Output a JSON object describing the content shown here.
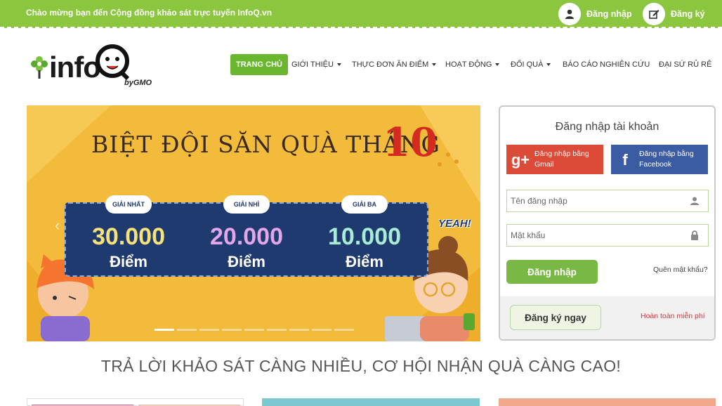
{
  "topbar": {
    "welcome": "Chào mừng bạn đến Cộng đồng khảo sát trực tuyến InfoQ.vn",
    "login_label": "Đăng nhập",
    "register_label": "Đăng ký",
    "bg_color": "#8cc63f"
  },
  "logo": {
    "text": "info",
    "by": "byGMO"
  },
  "nav": {
    "items": [
      {
        "label": "TRANG CHỦ",
        "active": true
      },
      {
        "label": "GIỚI THIỆU",
        "dropdown": true
      },
      {
        "label": "THỰC ĐƠN ĂN ĐIỂM",
        "dropdown": true
      },
      {
        "label": "HOẠT ĐỘNG",
        "dropdown": true
      },
      {
        "label": "ĐỔI QUÀ",
        "dropdown": true
      },
      {
        "label": "BÁO CÁO NGHIÊN CỨU"
      },
      {
        "label": "ĐẠI SỨ RỦ RÊ"
      }
    ],
    "accent": "#6ab72f"
  },
  "banner": {
    "title": "BIỆT ĐỘI SĂN QUÀ THÁNG",
    "month": "10",
    "prizes": [
      {
        "tab": "GIẢI NHẤT",
        "amount": "30.000",
        "unit": "Điểm",
        "color": "#f7e27a"
      },
      {
        "tab": "GIẢI NHÌ",
        "amount": "20.000",
        "unit": "Điểm",
        "color": "#e3a6e8"
      },
      {
        "tab": "GIẢI BA",
        "amount": "10.000",
        "unit": "Điểm",
        "color": "#a9ecd6"
      }
    ],
    "yeah": "YEAH!",
    "slide_count": 9,
    "active_slide": 1
  },
  "login": {
    "title": "Đăng nhập tài khoản",
    "gmail_line1": "Đăng nhập bằng",
    "gmail_line2": "Gmail",
    "facebook_line1": "Đăng nhập bằng",
    "facebook_line2": "Facebook",
    "username_placeholder": "Tên đăng nhập",
    "password_placeholder": "Mật khẩu",
    "login_button": "Đăng nhập",
    "forgot": "Quên mật khẩu?",
    "register_button": "Đăng ký ngay",
    "free_text": "Hoàn toàn miễn phí"
  },
  "tagline": "TRẢ LỜI KHẢO SÁT CÀNG NHIỀU, CƠ HỘI NHẬN QUÀ CÀNG CAO!"
}
